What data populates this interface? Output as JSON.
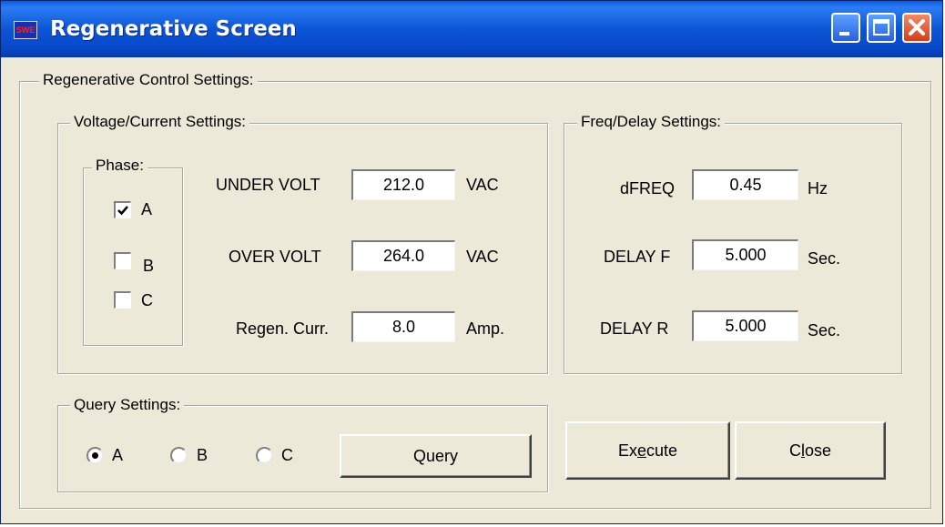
{
  "window": {
    "title": "Regenerative Screen",
    "icon_text": "SWE",
    "icon": "app-icon",
    "controls": [
      "minimize-icon",
      "maximize-icon",
      "close-icon"
    ]
  },
  "control_settings": {
    "label": "Regenerative Control Settings:",
    "voltage_current": {
      "label": "Voltage/Current Settings:",
      "phase": {
        "label": "Phase:",
        "items": [
          {
            "label": "A",
            "checked": true
          },
          {
            "label": "B",
            "checked": false
          },
          {
            "label": "C",
            "checked": false
          }
        ]
      },
      "under_volt": {
        "label": "UNDER VOLT",
        "value": "212.0",
        "unit": "VAC"
      },
      "over_volt": {
        "label": "OVER VOLT",
        "value": "264.0",
        "unit": "VAC"
      },
      "regen_curr": {
        "label": "Regen. Curr.",
        "value": "8.0",
        "unit": "Amp."
      }
    },
    "freq_delay": {
      "label": "Freq/Delay Settings:",
      "dfreq": {
        "label": "dFREQ",
        "value": "0.45",
        "unit": "Hz"
      },
      "delay_f": {
        "label": "DELAY F",
        "value": "5.000",
        "unit": "Sec."
      },
      "delay_r": {
        "label": "DELAY R",
        "value": "5.000",
        "unit": "Sec."
      }
    },
    "query": {
      "label": "Query Settings:",
      "options": [
        {
          "label": "A",
          "selected": true
        },
        {
          "label": "B",
          "selected": false
        },
        {
          "label": "C",
          "selected": false
        }
      ],
      "button": "Query"
    }
  },
  "buttons": {
    "execute_prefix": "Ex",
    "execute_mnemonic": "e",
    "execute_suffix": "cute",
    "close_prefix": "C",
    "close_mnemonic": "l",
    "close_suffix": "ose"
  },
  "colors": {
    "titlebar": "#0b55d6",
    "face": "#ece9d8",
    "close_button": "#d1401a"
  }
}
